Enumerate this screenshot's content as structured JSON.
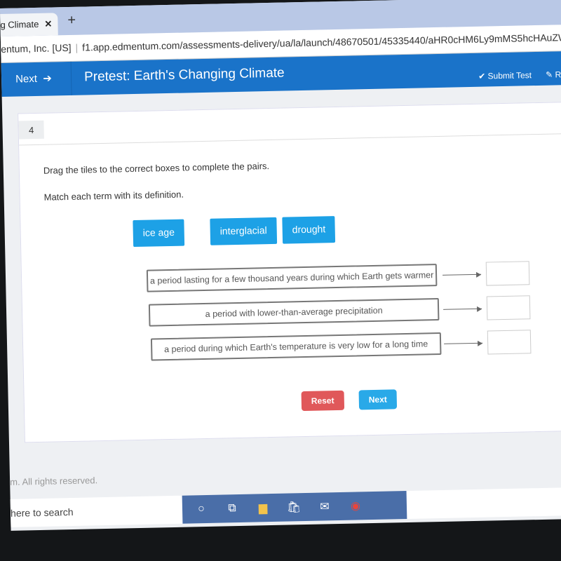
{
  "browser": {
    "tab_title": "g Climate",
    "address_owner": "entum, Inc. [US]",
    "url": "f1.app.edmentum.com/assessments-delivery/ua/la/launch/48670501/45335440/aHR0cHM6Ly9mMS5hcHAuZWRtZW50dW0uY29t"
  },
  "appbar": {
    "next": "Next",
    "title": "Pretest: Earth's Changing Climate",
    "submit": "Submit Test",
    "r": "R"
  },
  "question": {
    "number": "4",
    "instruction": "Drag the tiles to the correct boxes to complete the pairs.",
    "prompt": "Match each term with its definition.",
    "tiles": [
      "ice age",
      "interglacial",
      "drought"
    ],
    "definitions": [
      "a period lasting for a few thousand years during which Earth gets warmer",
      "a period with lower-than-average precipitation",
      "a period during which Earth's temperature is very low for a long time"
    ],
    "reset": "Reset",
    "next": "Next"
  },
  "footer": {
    "copyright": "m. All rights reserved."
  },
  "taskbar": {
    "search": "here to search",
    "icons": [
      "cortana-icon",
      "task-view-icon",
      "file-explorer-icon",
      "store-icon",
      "mail-icon",
      "chrome-icon"
    ]
  },
  "colors": {
    "appbar": "#1a73c9",
    "tile": "#1da1e6",
    "reset": "#e0585a",
    "next": "#29a9e8"
  }
}
